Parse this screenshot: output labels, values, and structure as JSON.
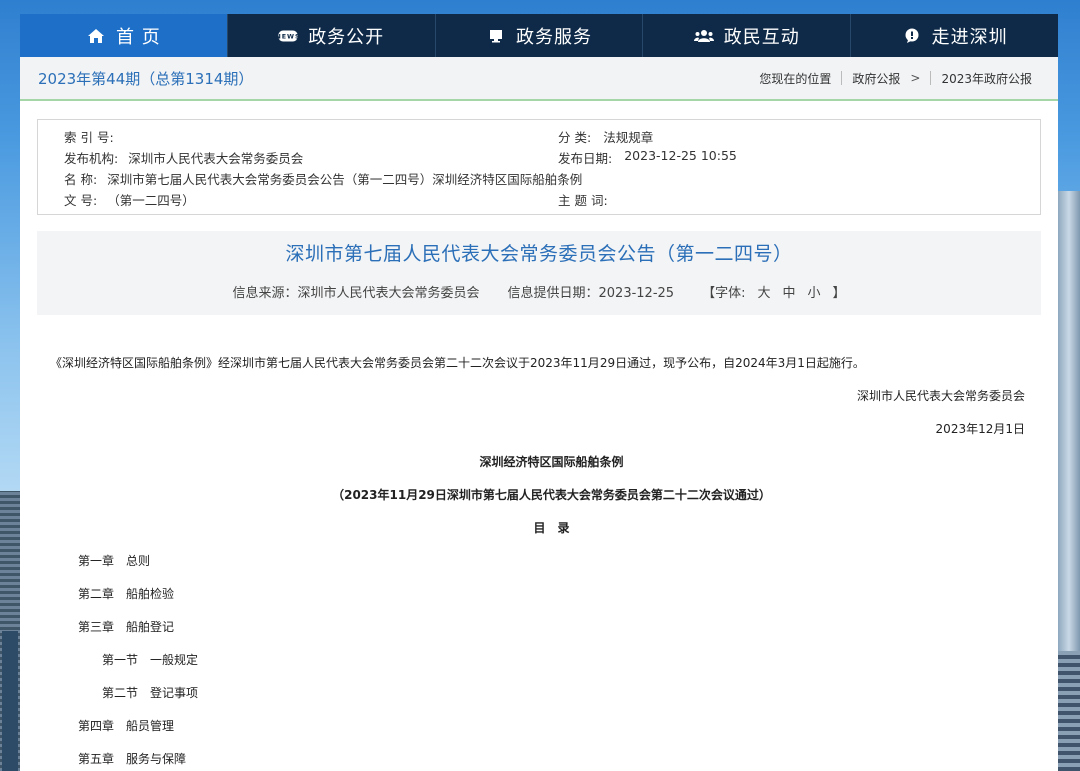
{
  "nav": {
    "items": [
      {
        "label": "首 页",
        "icon": "home-icon"
      },
      {
        "label": "政务公开",
        "icon": "news-icon"
      },
      {
        "label": "政务服务",
        "icon": "monitor-icon"
      },
      {
        "label": "政民互动",
        "icon": "people-icon"
      },
      {
        "label": "走进深圳",
        "icon": "chat-icon"
      }
    ],
    "active_index": 0,
    "active_color": "#1e6fc8",
    "bar_color": "#0e2a48"
  },
  "issue": {
    "title": "2023年第44期（总第1314期）"
  },
  "breadcrumb": {
    "current_label": "您现在的位置",
    "items": [
      "政府公报",
      "2023年政府公报"
    ],
    "separator": ">"
  },
  "meta": {
    "index_label": "索 引 号:",
    "index_value": "",
    "category_label": "分 类:",
    "category_value": "法规规章",
    "publisher_label": "发布机构:",
    "publisher_value": "深圳市人民代表大会常务委员会",
    "date_label": "发布日期:",
    "date_value": "2023-12-25 10:55",
    "name_label": "名 称:",
    "name_value": "深圳市第七届人民代表大会常务委员会公告（第一二四号）深圳经济特区国际船舶条例",
    "docno_label": "文 号:",
    "docno_value": "（第一二四号）",
    "keywords_label": "主 题 词:",
    "keywords_value": ""
  },
  "article": {
    "title": "深圳市第七届人民代表大会常务委员会公告（第一二四号）",
    "source": "信息来源：深圳市人民代表大会常务委员会",
    "provide_date": "信息提供日期：2023-12-25",
    "font_label_open": "【字体:",
    "font_sizes": [
      "大",
      "中",
      "小"
    ],
    "font_label_close": "】",
    "intro": "《深圳经济特区国际船舶条例》经深圳市第七届人民代表大会常务委员会第二十二次会议于2023年11月29日通过，现予公布，自2024年3月1日起施行。",
    "signer": "深圳市人民代表大会常务委员会",
    "sign_date": "2023年12月1日",
    "law_title": "深圳经济特区国际船舶条例",
    "law_subtitle": "（2023年11月29日深圳市第七届人民代表大会常务委员会第二十二次会议通过）",
    "toc_title": "目　录",
    "toc": [
      {
        "label": "第一章　总则",
        "level": 1
      },
      {
        "label": "第二章　船舶检验",
        "level": 1
      },
      {
        "label": "第三章　船舶登记",
        "level": 1
      },
      {
        "label": "第一节　一般规定",
        "level": 2
      },
      {
        "label": "第二节　登记事项",
        "level": 2
      },
      {
        "label": "第四章　船员管理",
        "level": 1
      },
      {
        "label": "第五章　服务与保障",
        "level": 1
      }
    ]
  }
}
